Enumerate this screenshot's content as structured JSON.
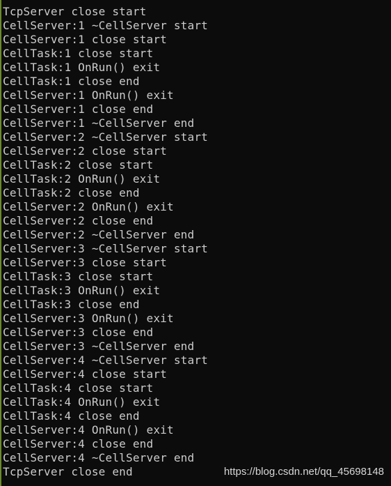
{
  "console": {
    "lines": [
      "TcpServer close start",
      "CellServer:1 ~CellServer start",
      "CellServer:1 close start",
      "CellTask:1 close start",
      "CellTask:1 OnRun() exit",
      "CellTask:1 close end",
      "CellServer:1 OnRun() exit",
      "CellServer:1 close end",
      "CellServer:1 ~CellServer end",
      "CellServer:2 ~CellServer start",
      "CellServer:2 close start",
      "CellTask:2 close start",
      "CellTask:2 OnRun() exit",
      "CellTask:2 close end",
      "CellServer:2 OnRun() exit",
      "CellServer:2 close end",
      "CellServer:2 ~CellServer end",
      "CellServer:3 ~CellServer start",
      "CellServer:3 close start",
      "CellTask:3 close start",
      "CellTask:3 OnRun() exit",
      "CellTask:3 close end",
      "CellServer:3 OnRun() exit",
      "CellServer:3 close end",
      "CellServer:3 ~CellServer end",
      "CellServer:4 ~CellServer start",
      "CellServer:4 close start",
      "CellTask:4 close start",
      "CellTask:4 OnRun() exit",
      "CellTask:4 close end",
      "CellServer:4 OnRun() exit",
      "CellServer:4 close end",
      "CellServer:4 ~CellServer end",
      "TcpServer close end"
    ]
  },
  "watermark": {
    "text": "https://blog.csdn.net/qq_45698148"
  },
  "colors": {
    "background": "#0c0c0c",
    "text": "#cccccc",
    "left_edge": "#6a8a2a"
  }
}
